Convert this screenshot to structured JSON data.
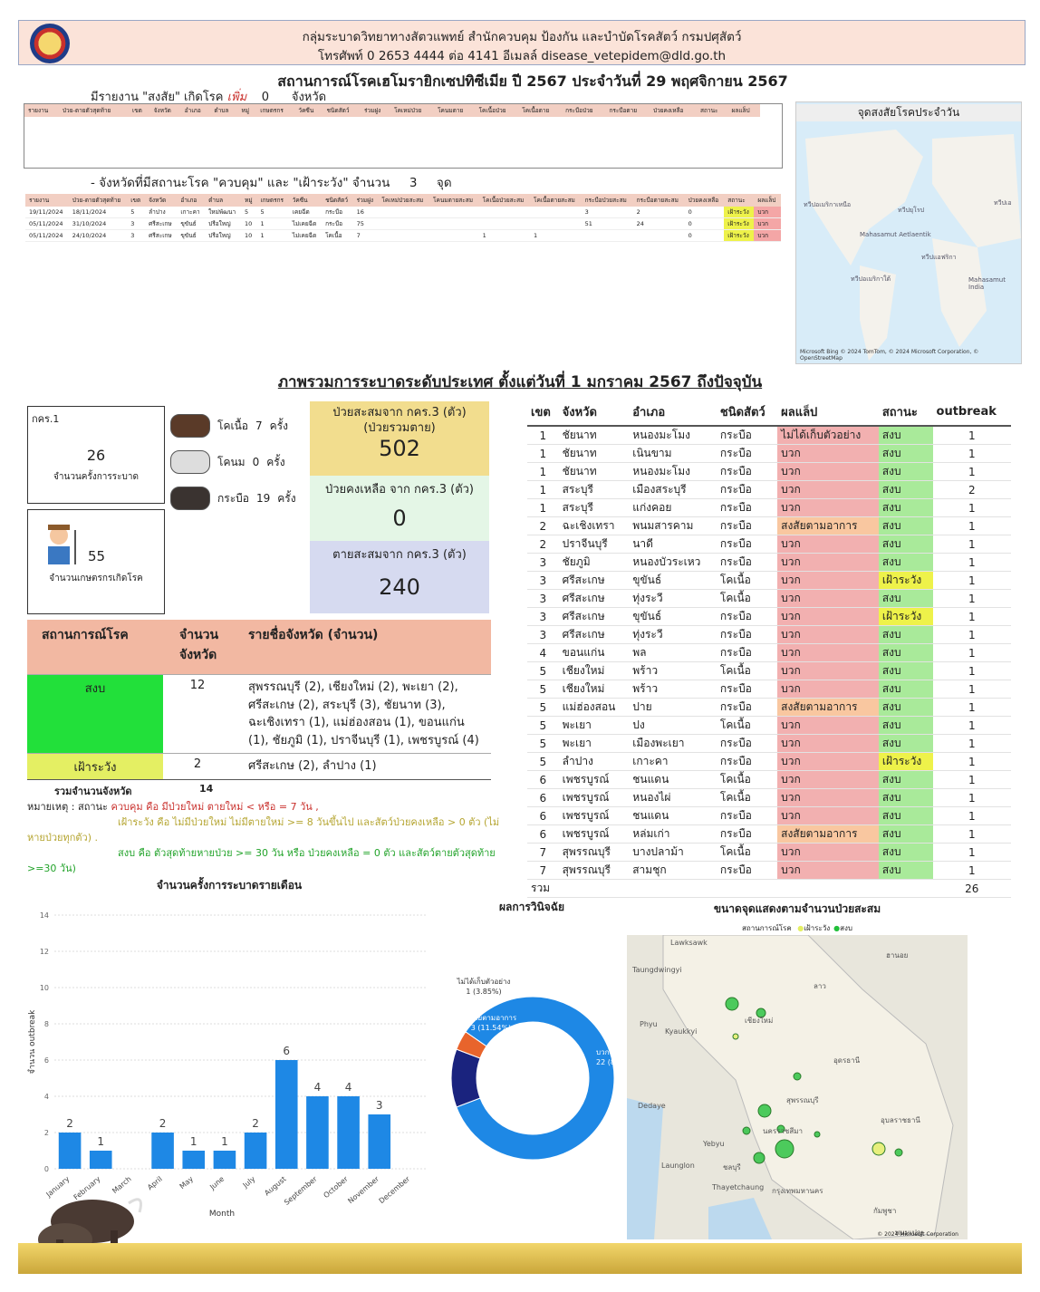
{
  "header": {
    "line1": "กลุ่มระบาดวิทยาทางสัตวแพทย์ สำนักควบคุม ป้องกัน และบำบัดโรคสัตว์ กรมปศุสัตว์",
    "line2": "โทรศัพท์ 0 2653 4444 ต่อ 4141 อีเมลล์ disease_vetepidem@dld.go.th"
  },
  "title": "สถานการณ์โรคเฮโมรายิกเซปทิซีเมีย   ปี 2567    ประจำวันที่ 29 พฤศจิกายน 2567",
  "suspect": {
    "prefix": "มีรายงาน  \"สงสัย\" เกิดโรค",
    "word": "เพิ่ม",
    "count": "0",
    "suffix": "จังหวัด"
  },
  "suspect_table_headers": [
    "รายงาน",
    "ป่วย-ตายตัวสุดท้าย",
    "เขต",
    "จังหวัด",
    "อำเภอ",
    "ตำบล",
    "หมู่",
    "เกษตรกร",
    "วัคซีน",
    "ชนิดสัตว์",
    "ร่วมฝูง",
    "โคเหม่ป่วย",
    "โคนมตาย",
    "โคเนื้อป่วย",
    "โคเนื้อตาย",
    "กระบือป่วย",
    "กระบือตาย",
    "ป่วยคงเหลือ",
    "สถานะ",
    "ผลแล็ป"
  ],
  "control": {
    "text": "- จังหวัดที่มีสถานะโรค \"ควบคุม\" และ \"เฝ้าระวัง\" จำนวน",
    "count": "3",
    "unit": "จุด"
  },
  "control_table": {
    "headers": [
      "รายงาน",
      "ป่วย-ตายตัวสุดท้าย",
      "เขต",
      "จังหวัด",
      "อำเภอ",
      "ตำบล",
      "หมู่",
      "เกษตรกร",
      "วัคซีน",
      "ชนิดสัตว์",
      "ร่วมฝูง",
      "โคเหม่ป่วยสะสม",
      "โคนมตายสะสม",
      "โคเนื้อป่วยสะสม",
      "โคเนื้อตายสะสม",
      "กระบือป่วยสะสม",
      "กระบือตายสะสม",
      "ป่วยคงเหลือ",
      "สถานะ",
      "ผลแล็ป"
    ],
    "rows": [
      [
        "19/11/2024",
        "18/11/2024",
        "5",
        "ลำปาง",
        "เกาะคา",
        "ใหม่พัฒนา",
        "5",
        "5",
        "เคยฉีด",
        "กระบือ",
        "16",
        "",
        "",
        "",
        "",
        "3",
        "2",
        "0",
        "เฝ้าระวัง",
        "บวก"
      ],
      [
        "05/11/2024",
        "31/10/2024",
        "3",
        "ศรีสะเกษ",
        "ขุขันธ์",
        "ปรือใหญ่",
        "10",
        "1",
        "ไม่เคยฉีด",
        "กระบือ",
        "75",
        "",
        "",
        "",
        "",
        "51",
        "24",
        "0",
        "เฝ้าระวัง",
        "บวก"
      ],
      [
        "05/11/2024",
        "24/10/2024",
        "3",
        "ศรีสะเกษ",
        "ขุขันธ์",
        "ปรือใหญ่",
        "10",
        "1",
        "ไม่เคยฉีด",
        "โคเนื้อ",
        "7",
        "",
        "",
        "1",
        "1",
        "",
        "",
        "0",
        "เฝ้าระวัง",
        "บวก"
      ]
    ]
  },
  "map1": {
    "title": "จุดสงสัยโรคประจำวัน",
    "labels": [
      "ทวีปอเมริกาเหนือ",
      "ทวีปยุโรป",
      "ทวีปเอ",
      "Mahasamut Aetlaentik",
      "ทวีปแอฟริกา",
      "ทวีปอเมริกาใต้",
      "Mahasamut India"
    ],
    "credit": "Microsoft Bing  © 2024 TomTom, © 2024 Microsoft Corporation, © OpenStreetMap"
  },
  "overview_title": "ภาพรวมการระบาดระดับประเทศ ตั้งแต่วันที่ 1 มกราคม 2567 ถึงปัจจุบัน",
  "kpi": {
    "kor_label": "กคร.1",
    "outbreak_count": "26",
    "outbreak_label": "จำนวนครั้งการระบาด",
    "farmers": "55",
    "farmers_label": "จำนวนเกษตรกรเกิดโรค",
    "animals": [
      {
        "name": "โคเนื้อ",
        "count": "7",
        "unit": "ครั้ง"
      },
      {
        "name": "โคนม",
        "count": "0",
        "unit": "ครั้ง"
      },
      {
        "name": "กระบือ",
        "count": "19",
        "unit": "ครั้ง"
      }
    ],
    "sick_label": "ป่วยสะสมจาก กคร.3 (ตัว)\n(ป่วยรวมตาย)",
    "sick_value": "502",
    "remain_label": "ป่วยคงเหลือ จาก กคร.3 (ตัว)",
    "remain_value": "0",
    "dead_label": "ตายสะสมจาก กคร.3 (ตัว)",
    "dead_value": "240"
  },
  "status_table": {
    "headers": [
      "สถานการณ์โรค",
      "จำนวนจังหวัด",
      "รายชื่อจังหวัด (จำนวน)"
    ],
    "rows": [
      {
        "status": "สงบ",
        "count": "12",
        "list": "สุพรรณบุรี (2), เชียงใหม่ (2), พะเยา (2), ศรีสะเกษ (2), สระบุรี (3), ชัยนาท (3), ฉะเชิงเทรา (1), แม่ฮ่องสอน (1), ขอนแก่น (1), ชัยภูมิ (1), ปราจีนบุรี (1), เพชรบูรณ์ (4)",
        "color": "#22e03a"
      },
      {
        "status": "เฝ้าระวัง",
        "count": "2",
        "list": "ศรีสะเกษ (2), ลำปาง (1)",
        "color": "#e4ef63"
      }
    ],
    "total_label": "รวมจำนวนจังหวัด",
    "total": "14"
  },
  "notes": {
    "prefix": "หมายเหตุ : สถานะ",
    "red": "ควบคุม คือ มีป่วยใหม่ ตายใหม่ < หรือ = 7 วัน ,",
    "yellow": "เฝ้าระวัง คือ  ไม่มีป่วยใหม่ ไม่มีตายใหม่   >= 8 วันขึ้นไป  และสัตว์ป่วยคงเหลือ > 0 ตัว (ไม่หายป่วยทุกตัว) .",
    "green": "สงบ คือ  ตัวสุดท้ายหายป่วย >= 30 วัน หรือ ป่วยคงเหลือ = 0 ตัว และสัตว์ตายตัวสุดท้าย >=30 วัน)"
  },
  "right_table": {
    "headers": [
      "เขต",
      "จังหวัด",
      "อำเภอ",
      "ชนิดสัตว์",
      "ผลแล็ป",
      "สถานะ",
      "outbreak"
    ],
    "rows": [
      [
        "1",
        "ชัยนาท",
        "หนองมะโมง",
        "กระบือ",
        "ไม่ได้เก็บตัวอย่าง",
        "สงบ",
        "1"
      ],
      [
        "1",
        "ชัยนาท",
        "เนินขาม",
        "กระบือ",
        "บวก",
        "สงบ",
        "1"
      ],
      [
        "1",
        "ชัยนาท",
        "หนองมะโมง",
        "กระบือ",
        "บวก",
        "สงบ",
        "1"
      ],
      [
        "1",
        "สระบุรี",
        "เมืองสระบุรี",
        "กระบือ",
        "บวก",
        "สงบ",
        "2"
      ],
      [
        "1",
        "สระบุรี",
        "แก่งคอย",
        "กระบือ",
        "บวก",
        "สงบ",
        "1"
      ],
      [
        "2",
        "ฉะเชิงเทรา",
        "พนมสารคาม",
        "กระบือ",
        "สงสัยตามอาการ",
        "สงบ",
        "1"
      ],
      [
        "2",
        "ปราจีนบุรี",
        "นาดี",
        "กระบือ",
        "บวก",
        "สงบ",
        "1"
      ],
      [
        "3",
        "ชัยภูมิ",
        "หนองบัวระเหว",
        "กระบือ",
        "บวก",
        "สงบ",
        "1"
      ],
      [
        "3",
        "ศรีสะเกษ",
        "ขุขันธ์",
        "โคเนื้อ",
        "บวก",
        "เฝ้าระวัง",
        "1"
      ],
      [
        "3",
        "ศรีสะเกษ",
        "ทุ่งระวี",
        "โคเนื้อ",
        "บวก",
        "สงบ",
        "1"
      ],
      [
        "3",
        "ศรีสะเกษ",
        "ขุขันธ์",
        "กระบือ",
        "บวก",
        "เฝ้าระวัง",
        "1"
      ],
      [
        "3",
        "ศรีสะเกษ",
        "ทุ่งระวี",
        "กระบือ",
        "บวก",
        "สงบ",
        "1"
      ],
      [
        "4",
        "ขอนแก่น",
        "พล",
        "กระบือ",
        "บวก",
        "สงบ",
        "1"
      ],
      [
        "5",
        "เชียงใหม่",
        "พร้าว",
        "โคเนื้อ",
        "บวก",
        "สงบ",
        "1"
      ],
      [
        "5",
        "เชียงใหม่",
        "พร้าว",
        "กระบือ",
        "บวก",
        "สงบ",
        "1"
      ],
      [
        "5",
        "แม่ฮ่องสอน",
        "ปาย",
        "กระบือ",
        "สงสัยตามอาการ",
        "สงบ",
        "1"
      ],
      [
        "5",
        "พะเยา",
        "ปง",
        "โคเนื้อ",
        "บวก",
        "สงบ",
        "1"
      ],
      [
        "5",
        "พะเยา",
        "เมืองพะเยา",
        "กระบือ",
        "บวก",
        "สงบ",
        "1"
      ],
      [
        "5",
        "ลำปาง",
        "เกาะคา",
        "กระบือ",
        "บวก",
        "เฝ้าระวัง",
        "1"
      ],
      [
        "6",
        "เพชรบูรณ์",
        "ชนแดน",
        "โคเนื้อ",
        "บวก",
        "สงบ",
        "1"
      ],
      [
        "6",
        "เพชรบูรณ์",
        "หนองไผ่",
        "โคเนื้อ",
        "บวก",
        "สงบ",
        "1"
      ],
      [
        "6",
        "เพชรบูรณ์",
        "ชนแดน",
        "กระบือ",
        "บวก",
        "สงบ",
        "1"
      ],
      [
        "6",
        "เพชรบูรณ์",
        "หล่มเก่า",
        "กระบือ",
        "สงสัยตามอาการ",
        "สงบ",
        "1"
      ],
      [
        "7",
        "สุพรรณบุรี",
        "บางปลาม้า",
        "โคเนื้อ",
        "บวก",
        "สงบ",
        "1"
      ],
      [
        "7",
        "สุพรรณบุรี",
        "สามชุก",
        "กระบือ",
        "บวก",
        "สงบ",
        "1"
      ]
    ],
    "total_label": "รวม",
    "total": "26"
  },
  "chart_data": [
    {
      "type": "bar",
      "title": "จำนวนครั้งการระบาดรายเดือน",
      "xlabel": "Month",
      "ylabel": "จำนวน outbreak",
      "categories": [
        "January",
        "February",
        "March",
        "April",
        "May",
        "June",
        "July",
        "August",
        "September",
        "October",
        "November",
        "December"
      ],
      "values": [
        2,
        1,
        0,
        2,
        1,
        1,
        2,
        6,
        4,
        4,
        3,
        0
      ],
      "ylim": [
        0,
        14
      ],
      "yticks": [
        0,
        2,
        4,
        6,
        8,
        10,
        12,
        14
      ],
      "color": "#1e88e5"
    },
    {
      "type": "pie",
      "title": "ผลการวินิจฉัย",
      "slices": [
        {
          "label": "บวก",
          "value": 22,
          "display": "22 (84.62%)",
          "color": "#1e88e5"
        },
        {
          "label": "สงสัยตามอาการ",
          "value": 3,
          "display": "3 (11.54%)",
          "color": "#1a237e"
        },
        {
          "label": "ไม่ได้เก็บตัวอย่าง",
          "value": 1,
          "display": "1 (3.85%)",
          "color": "#e8642c"
        }
      ]
    }
  ],
  "map2": {
    "title": "ขนาดจุดแสดงตามจำนวนป่วยสะสม",
    "legend_title": "สถานการณ์โรค",
    "legend": [
      {
        "label": "เฝ้าระวัง",
        "color": "#e4ef63"
      },
      {
        "label": "สงบ",
        "color": "#22c03a"
      }
    ],
    "places": [
      "Lawksawk",
      "Taungdwingyi",
      "Phyu",
      "Kyaukkyi",
      "Dedaye",
      "Yebyu",
      "Launglon",
      "Thayetchaung",
      "กรุงเทพมหานคร",
      "ฮานอย",
      "เชียงใหม่",
      "ลาว",
      "อุดรธานี",
      "นครราชสีมา",
      "อุบลราชธานี",
      "กัมพูชา",
      "ชลบุรี",
      "สุพรรณบุรี",
      "พนมเปญ"
    ],
    "credit": "© 2024 Microsoft Corporation"
  }
}
